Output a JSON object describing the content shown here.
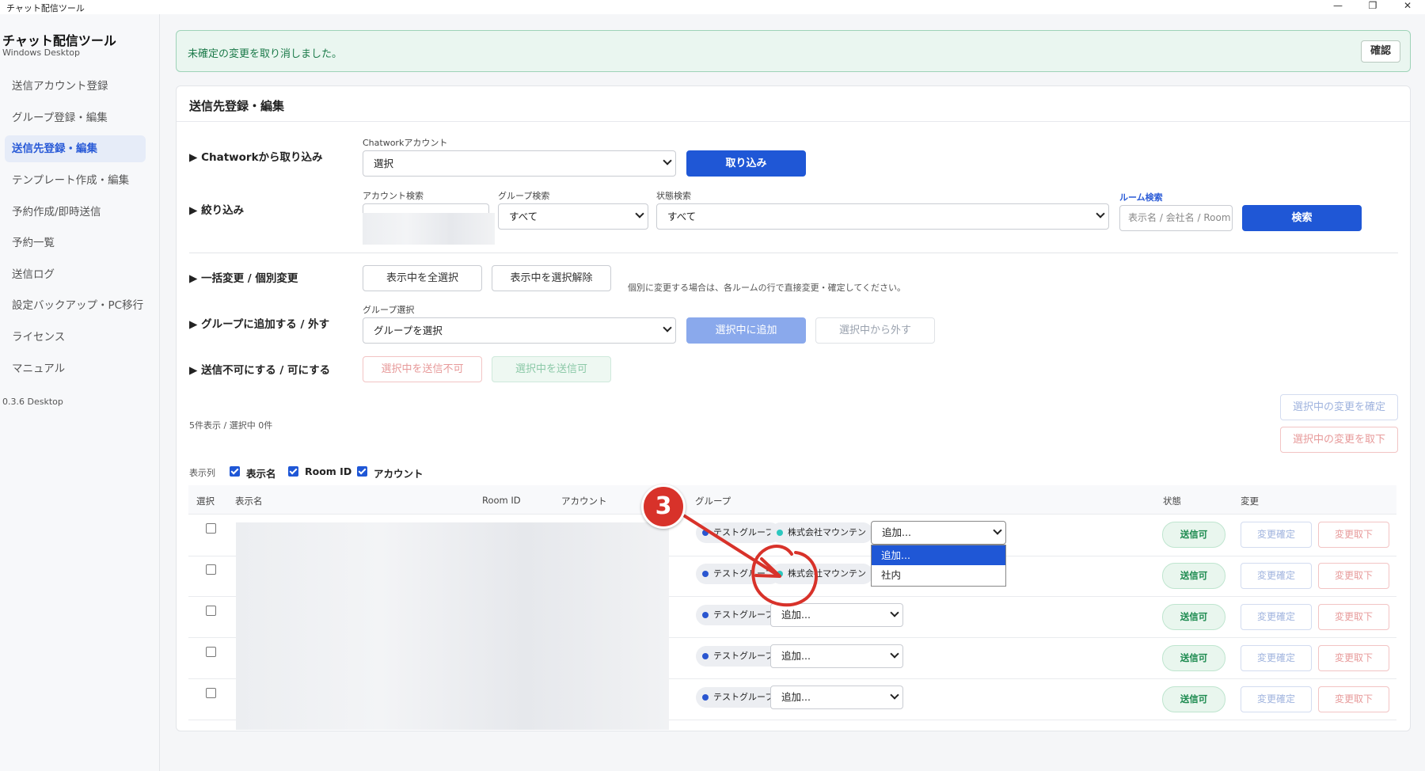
{
  "window": {
    "title": "チャット配信ツール",
    "minimize": "—",
    "maximize": "❐",
    "close": "✕"
  },
  "sidebar": {
    "app_title": "チャット配信ツール",
    "app_subtitle": "Windows Desktop",
    "items": [
      {
        "label": "送信アカウント登録"
      },
      {
        "label": "グループ登録・編集"
      },
      {
        "label": "送信先登録・編集"
      },
      {
        "label": "テンプレート作成・編集"
      },
      {
        "label": "予約作成/即時送信"
      },
      {
        "label": "予約一覧"
      },
      {
        "label": "送信ログ"
      },
      {
        "label": "設定バックアップ・PC移行"
      },
      {
        "label": "ライセンス"
      },
      {
        "label": "マニュアル"
      }
    ],
    "version": "0.3.6 Desktop"
  },
  "notice": {
    "text": "未確定の変更を取り消しました。",
    "button": "確認"
  },
  "panel": {
    "title": "送信先登録・編集",
    "import": {
      "label": "▶ Chatworkから取り込み",
      "account_label": "Chatworkアカウント",
      "account_value": "選択",
      "button": "取り込み"
    },
    "filter": {
      "label": "▶ 絞り込み",
      "account_search_label": "アカウント検索",
      "group_search_label": "グループ検索",
      "group_search_value": "すべて",
      "status_search_label": "状態検索",
      "status_search_value": "すべて",
      "room_search_label": "ルーム検索",
      "room_search_placeholder": "表示名 / 会社名 / Room",
      "search_button": "検索"
    },
    "bulk": {
      "label": "▶ 一括変更 / 個別変更",
      "select_all": "表示中を全選択",
      "deselect_all": "表示中を選択解除",
      "hint": "個別に変更する場合は、各ルームの行で直接変更・確定してください。"
    },
    "group_assign": {
      "label": "▶ グループに追加する / 外す",
      "select_label": "グループ選択",
      "select_value": "グループを選択",
      "add_button": "選択中に追加",
      "remove_button": "選択中から外す"
    },
    "sendable": {
      "label": "▶ 送信不可にする / 可にする",
      "disable_button": "選択中を送信不可",
      "enable_button": "選択中を送信可"
    },
    "confirm_selected": "選択中の変更を確定",
    "revert_selected": "選択中の変更を取下",
    "count_text": "5件表示 / 選択中 0件",
    "columns_label": "表示列",
    "column_toggles": [
      {
        "label": "表示名"
      },
      {
        "label": "Room ID"
      },
      {
        "label": "アカウント"
      }
    ]
  },
  "table": {
    "headers": {
      "select": "選択",
      "name": "表示名",
      "room_id": "Room ID",
      "account": "アカウント",
      "group": "グループ",
      "status": "状態",
      "change": "変更"
    },
    "rows": [
      {
        "groups": [
          "テストグループ",
          "株式会社マウンテン"
        ],
        "add_value": "追加...",
        "status": "送信可",
        "confirm": "変更確定",
        "revert": "変更取下"
      },
      {
        "groups": [
          "テストグループ",
          "株式会社マウンテン"
        ],
        "add_value": "",
        "status": "送信可",
        "confirm": "変更確定",
        "revert": "変更取下"
      },
      {
        "groups": [
          "テストグループ"
        ],
        "add_value": "追加...",
        "status": "送信可",
        "confirm": "変更確定",
        "revert": "変更取下"
      },
      {
        "groups": [
          "テストグループ"
        ],
        "add_value": "追加...",
        "status": "送信可",
        "confirm": "変更確定",
        "revert": "変更取下"
      },
      {
        "groups": [
          "テストグループ"
        ],
        "add_value": "追加...",
        "status": "送信可",
        "confirm": "変更確定",
        "revert": "変更取下"
      }
    ],
    "dropdown_options": [
      "追加...",
      "社内"
    ]
  },
  "annotation": {
    "step_number": "3",
    "color": "#d8322a"
  }
}
